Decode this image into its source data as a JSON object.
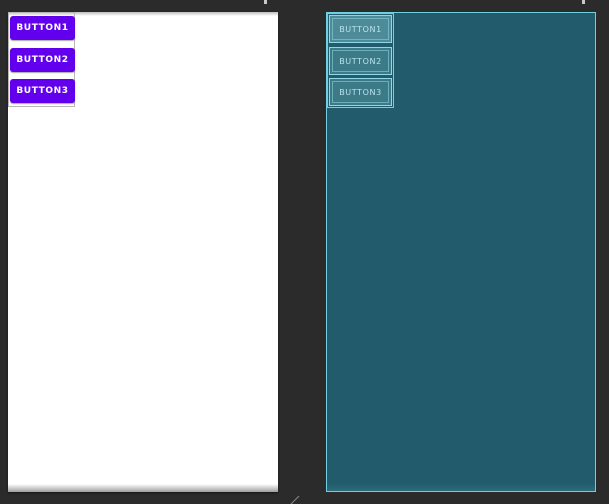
{
  "design_view": {
    "buttons": [
      {
        "label": "BUTTON1"
      },
      {
        "label": "BUTTON2"
      },
      {
        "label": "BUTTON3"
      }
    ]
  },
  "blueprint_view": {
    "buttons": [
      {
        "label": "BUTTON1"
      },
      {
        "label": "BUTTON2"
      },
      {
        "label": "BUTTON3"
      }
    ]
  },
  "colors": {
    "canvas_background": "#2b2b2b",
    "button_primary": "#6200ee",
    "blueprint_background": "#225b6b",
    "blueprint_outline": "#6fd0e3"
  }
}
